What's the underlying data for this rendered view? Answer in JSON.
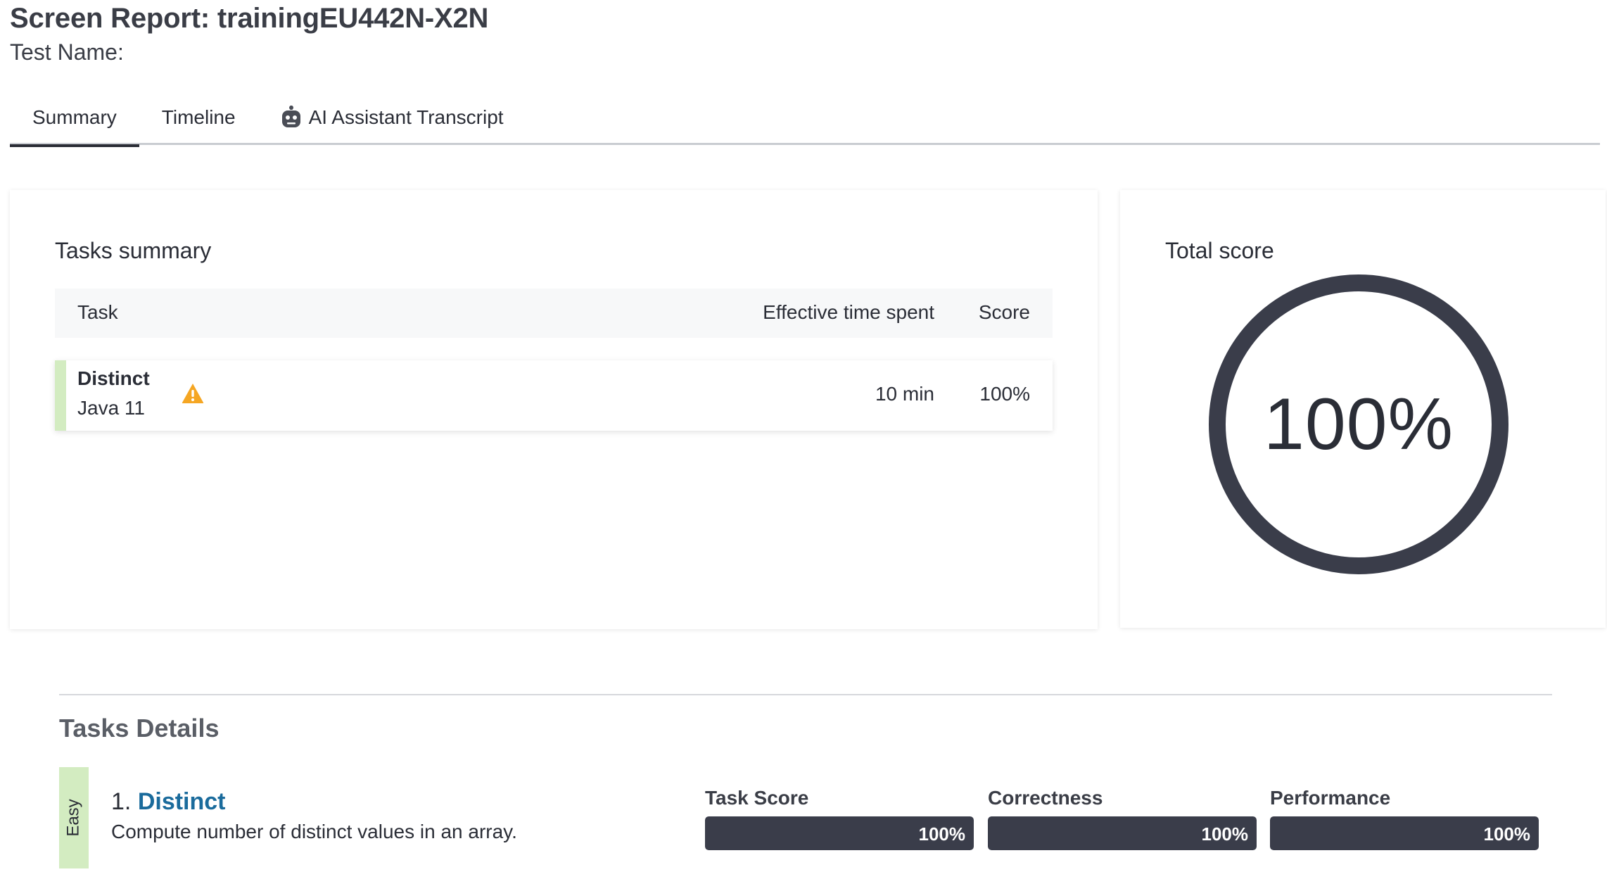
{
  "header": {
    "title": "Screen Report: trainingEU442N-X2N",
    "test_name_label": "Test Name:"
  },
  "tabs": [
    {
      "label": "Summary",
      "active": true
    },
    {
      "label": "Timeline",
      "active": false
    },
    {
      "label": "AI Assistant Transcript",
      "active": false,
      "icon": "robot-icon"
    }
  ],
  "tasks_summary": {
    "heading": "Tasks summary",
    "columns": {
      "task": "Task",
      "time": "Effective time spent",
      "score": "Score"
    },
    "rows": [
      {
        "name": "Distinct",
        "language": "Java 11",
        "icon": "warning-icon",
        "time": "10 min",
        "score": "100%"
      }
    ]
  },
  "total_score": {
    "heading": "Total score",
    "value": "100%",
    "fraction": 1.0
  },
  "tasks_details": {
    "heading": "Tasks Details",
    "tasks": [
      {
        "difficulty": "Easy",
        "number": "1.",
        "name": "Distinct",
        "description": "Compute number of distinct values in an array.",
        "metrics": [
          {
            "label": "Task Score",
            "value": "100%",
            "fraction": 1.0
          },
          {
            "label": "Correctness",
            "value": "100%",
            "fraction": 1.0
          },
          {
            "label": "Performance",
            "value": "100%",
            "fraction": 1.0
          }
        ]
      }
    ]
  },
  "colors": {
    "accent_dark": "#3a3d4a",
    "easy_green": "#d3ecc1",
    "link_blue": "#1a6b9c",
    "warning_orange": "#f5a623"
  }
}
